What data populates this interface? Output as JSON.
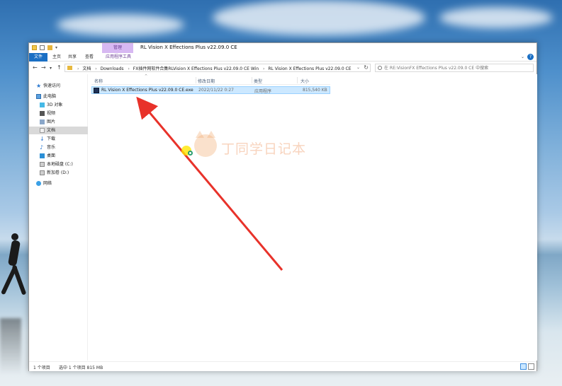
{
  "window": {
    "title": "RL Vision X Effections Plus v22.09.0 CE",
    "manage_tab": "管理"
  },
  "ribbon": {
    "tabs": [
      "文件",
      "主页",
      "共享",
      "查看",
      "应用程序工具"
    ]
  },
  "address": {
    "crumbs": [
      "文档",
      "Downloads",
      "FX插件网软件合集RLVision X Effections Plus v22.09.0 CE Win",
      "RL Vision X Effections Plus v22.09.0 CE"
    ],
    "search_placeholder": "在 RE:VisionFX Effections Plus v22.09.0 CE 中搜索"
  },
  "sidebar": {
    "items": [
      {
        "label": "快速访问",
        "icon": "star-icon"
      },
      {
        "label": "此电脑",
        "icon": "computer-icon"
      },
      {
        "label": "3D 对象",
        "icon": "3d-objects-icon"
      },
      {
        "label": "视频",
        "icon": "video-icon"
      },
      {
        "label": "图片",
        "icon": "pictures-icon"
      },
      {
        "label": "文档",
        "icon": "documents-icon"
      },
      {
        "label": "下载",
        "icon": "download-icon"
      },
      {
        "label": "音乐",
        "icon": "music-icon"
      },
      {
        "label": "桌面",
        "icon": "desktop-icon"
      },
      {
        "label": "本地磁盘 (C:)",
        "icon": "drive-icon"
      },
      {
        "label": "新加卷 (D:)",
        "icon": "drive-icon"
      },
      {
        "label": "网络",
        "icon": "network-icon"
      }
    ],
    "selected_index": 5
  },
  "columns": {
    "name": "名称",
    "date": "修改日期",
    "type": "类型",
    "size": "大小"
  },
  "files": [
    {
      "name": "RL Vision X Effections Plus v22.09.0 CE.exe",
      "date": "2022/11/22 0:27",
      "type": "应用程序",
      "size": "815,540 KB"
    }
  ],
  "watermark": {
    "text": "丁同学日记本"
  },
  "status": {
    "count": "1 个项目",
    "selected": "选中 1 个项目  815 MB"
  },
  "colors": {
    "accent": "#1a6fc4",
    "selection": "#cce8ff",
    "arrow": "#e8322a",
    "manage_tab": "#d7b8f2"
  }
}
